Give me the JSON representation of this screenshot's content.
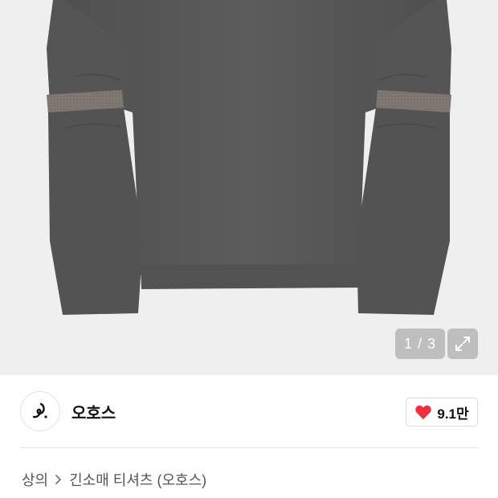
{
  "gallery": {
    "counter": "1 / 3",
    "current_image": 1,
    "total_images": 3
  },
  "brand": {
    "name": "오호스",
    "logo_icon": "brand-swirl-logo"
  },
  "like": {
    "count": "9.1만",
    "icon": "heart-icon",
    "color": "#f0303e"
  },
  "breadcrumb": {
    "items": [
      "상의",
      "긴소매 티셔츠 (오호스)"
    ]
  },
  "colors": {
    "garment": "#5a5a5a",
    "gallery_bg": "#efefef",
    "overlay": "#969696"
  }
}
